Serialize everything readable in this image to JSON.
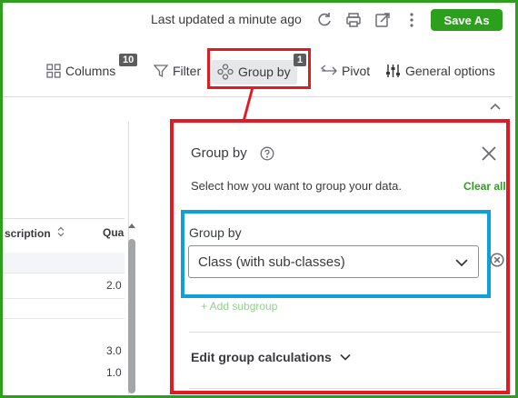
{
  "header": {
    "last_updated": "Last updated a minute ago",
    "save_label": "Save As"
  },
  "toolbar": {
    "columns_label": "Columns",
    "columns_count": "10",
    "filter_label": "Filter",
    "group_by_label": "Group by",
    "group_by_count": "1",
    "pivot_label": "Pivot",
    "general_options_label": "General options"
  },
  "table": {
    "columns": [
      "scription",
      "Qua"
    ],
    "values": [
      "2.0",
      "3.0",
      "1.0"
    ]
  },
  "group_panel": {
    "title": "Group by",
    "subtitle": "Select how you want to group your data.",
    "clear_all": "Clear all",
    "field_label": "Group by",
    "selected_value": "Class (with sub-classes)",
    "add_subgroup": "+ Add subgroup",
    "edit_calculations": "Edit group calculations"
  },
  "colors": {
    "brand_green": "#2ca01c",
    "highlight_red": "#e21b22",
    "highlight_blue": "#0ea0dc"
  },
  "icons": [
    "refresh-icon",
    "print-icon",
    "export-icon",
    "more-vertical-icon",
    "columns-icon",
    "filter-icon",
    "group-by-icon",
    "pivot-icon",
    "general-options-icon",
    "chevron-up-icon",
    "help-icon",
    "close-icon",
    "chevron-down-icon",
    "remove-circle-icon",
    "sort-icon"
  ]
}
